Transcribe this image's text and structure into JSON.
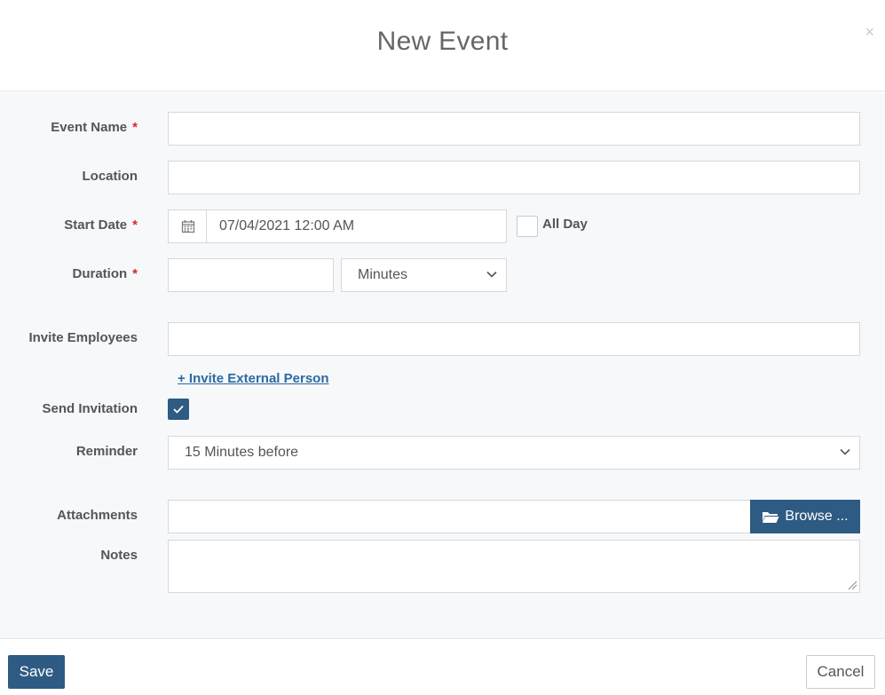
{
  "header": {
    "title": "New Event",
    "close_label": "×"
  },
  "form": {
    "event_name": {
      "label": "Event Name",
      "required_mark": "*",
      "value": ""
    },
    "location": {
      "label": "Location",
      "value": ""
    },
    "start_date": {
      "label": "Start Date",
      "required_mark": "*",
      "value": "07/04/2021 12:00 AM",
      "all_day_label": "All Day",
      "all_day_checked": false
    },
    "duration": {
      "label": "Duration",
      "required_mark": "*",
      "value": "",
      "unit_selected": "Minutes"
    },
    "invite_employees": {
      "label": "Invite Employees",
      "value": ""
    },
    "invite_external_link": "+ Invite External Person",
    "send_invitation": {
      "label": "Send Invitation",
      "checked": true
    },
    "reminder": {
      "label": "Reminder",
      "selected": "15 Minutes before"
    },
    "attachments": {
      "label": "Attachments",
      "value": "",
      "browse_label": "Browse ..."
    },
    "notes": {
      "label": "Notes",
      "value": ""
    }
  },
  "footer": {
    "save_label": "Save",
    "cancel_label": "Cancel"
  },
  "colors": {
    "primary": "#2e5b83",
    "required": "#d9262c",
    "link": "#2d6aa0"
  }
}
